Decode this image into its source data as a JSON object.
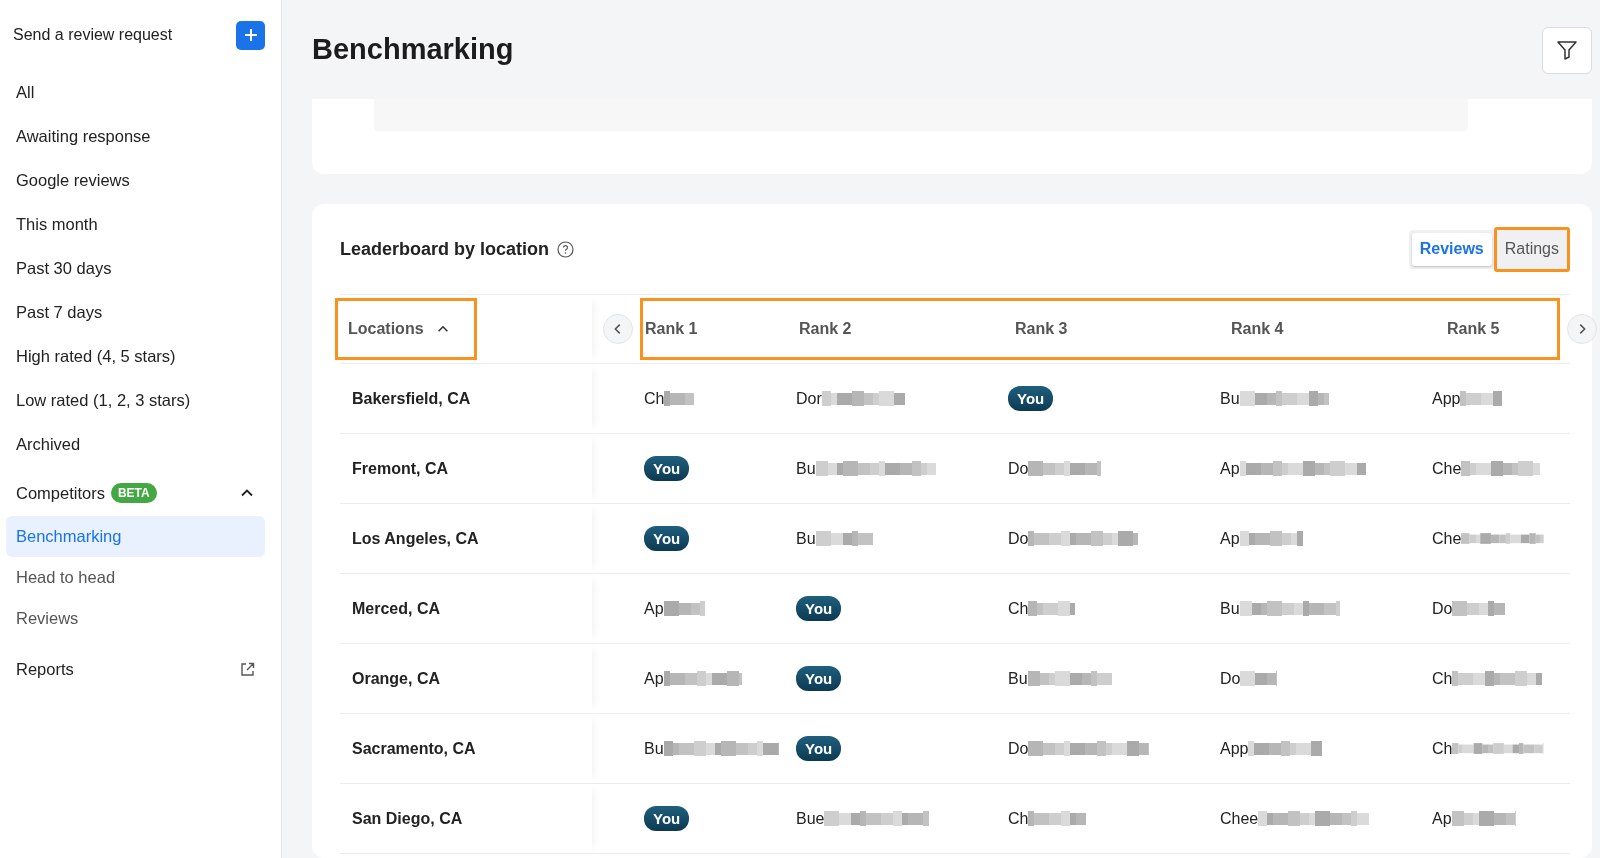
{
  "sidebar": {
    "send_request": {
      "label": "Send a review request"
    },
    "items": [
      {
        "label": "All",
        "selected": false
      },
      {
        "label": "Awaiting response",
        "selected": false
      },
      {
        "label": "Google reviews",
        "selected": false
      },
      {
        "label": "This month",
        "selected": false
      },
      {
        "label": "Past 30 days",
        "selected": false
      },
      {
        "label": "Past 7 days",
        "selected": false
      },
      {
        "label": "High rated (4, 5 stars)",
        "selected": false
      },
      {
        "label": "Low rated (1, 2, 3 stars)",
        "selected": false
      },
      {
        "label": "Archived",
        "selected": false
      }
    ],
    "group": {
      "label": "Competitors",
      "badge": "BETA",
      "expanded": true,
      "children": [
        {
          "label": "Benchmarking",
          "selected": true
        },
        {
          "label": "Head to head",
          "selected": false
        },
        {
          "label": "Reviews",
          "selected": false
        }
      ]
    },
    "footer_items": [
      {
        "label": "Reports",
        "kind": "external"
      }
    ]
  },
  "page": {
    "title": "Benchmarking"
  },
  "leaderboard": {
    "title": "Leaderboard by location",
    "toggle": [
      {
        "label": "Reviews",
        "selected": true,
        "highlighted": false
      },
      {
        "label": "Ratings",
        "selected": false,
        "highlighted": true
      }
    ],
    "locations_header": {
      "label": "Locations",
      "sort_ascending": true,
      "highlighted": true
    },
    "rank_headers_highlighted": true,
    "rank_columns": [
      "Rank 1",
      "Rank 2",
      "Rank 3",
      "Rank 4",
      "Rank 5"
    ],
    "rows": [
      {
        "location": "Bakersfield, CA",
        "cells": [
          {
            "kind": "name",
            "text": "Ch"
          },
          {
            "kind": "name",
            "text": "Dor"
          },
          {
            "kind": "you",
            "text": "You"
          },
          {
            "kind": "name",
            "text": "Bu"
          },
          {
            "kind": "name",
            "text": "App"
          }
        ]
      },
      {
        "location": "Fremont, CA",
        "cells": [
          {
            "kind": "you",
            "text": "You"
          },
          {
            "kind": "name",
            "text": "Bu"
          },
          {
            "kind": "name",
            "text": "Do"
          },
          {
            "kind": "name",
            "text": "Ap"
          },
          {
            "kind": "name",
            "text": "Che"
          }
        ]
      },
      {
        "location": "Los Angeles, CA",
        "cells": [
          {
            "kind": "you",
            "text": "You"
          },
          {
            "kind": "name",
            "text": "Bu"
          },
          {
            "kind": "name",
            "text": "Do"
          },
          {
            "kind": "name",
            "text": "Ap"
          },
          {
            "kind": "name",
            "text": "Che"
          }
        ]
      },
      {
        "location": "Merced, CA",
        "cells": [
          {
            "kind": "name",
            "text": "Ap"
          },
          {
            "kind": "you",
            "text": "You"
          },
          {
            "kind": "name",
            "text": "Ch"
          },
          {
            "kind": "name",
            "text": "Bu"
          },
          {
            "kind": "name",
            "text": "Do"
          }
        ]
      },
      {
        "location": "Orange, CA",
        "cells": [
          {
            "kind": "name",
            "text": "Ap"
          },
          {
            "kind": "you",
            "text": "You"
          },
          {
            "kind": "name",
            "text": "Bu"
          },
          {
            "kind": "name",
            "text": "Do"
          },
          {
            "kind": "name",
            "text": "Ch"
          }
        ]
      },
      {
        "location": "Sacramento, CA",
        "cells": [
          {
            "kind": "name",
            "text": "Bu"
          },
          {
            "kind": "you",
            "text": "You"
          },
          {
            "kind": "name",
            "text": "Do"
          },
          {
            "kind": "name",
            "text": "App"
          },
          {
            "kind": "name",
            "text": "Ch"
          }
        ]
      },
      {
        "location": "San Diego, CA",
        "cells": [
          {
            "kind": "you",
            "text": "You"
          },
          {
            "kind": "name",
            "text": "Bue"
          },
          {
            "kind": "name",
            "text": "Ch"
          },
          {
            "kind": "name",
            "text": "Chee"
          },
          {
            "kind": "name",
            "text": "Ap"
          }
        ]
      }
    ]
  }
}
